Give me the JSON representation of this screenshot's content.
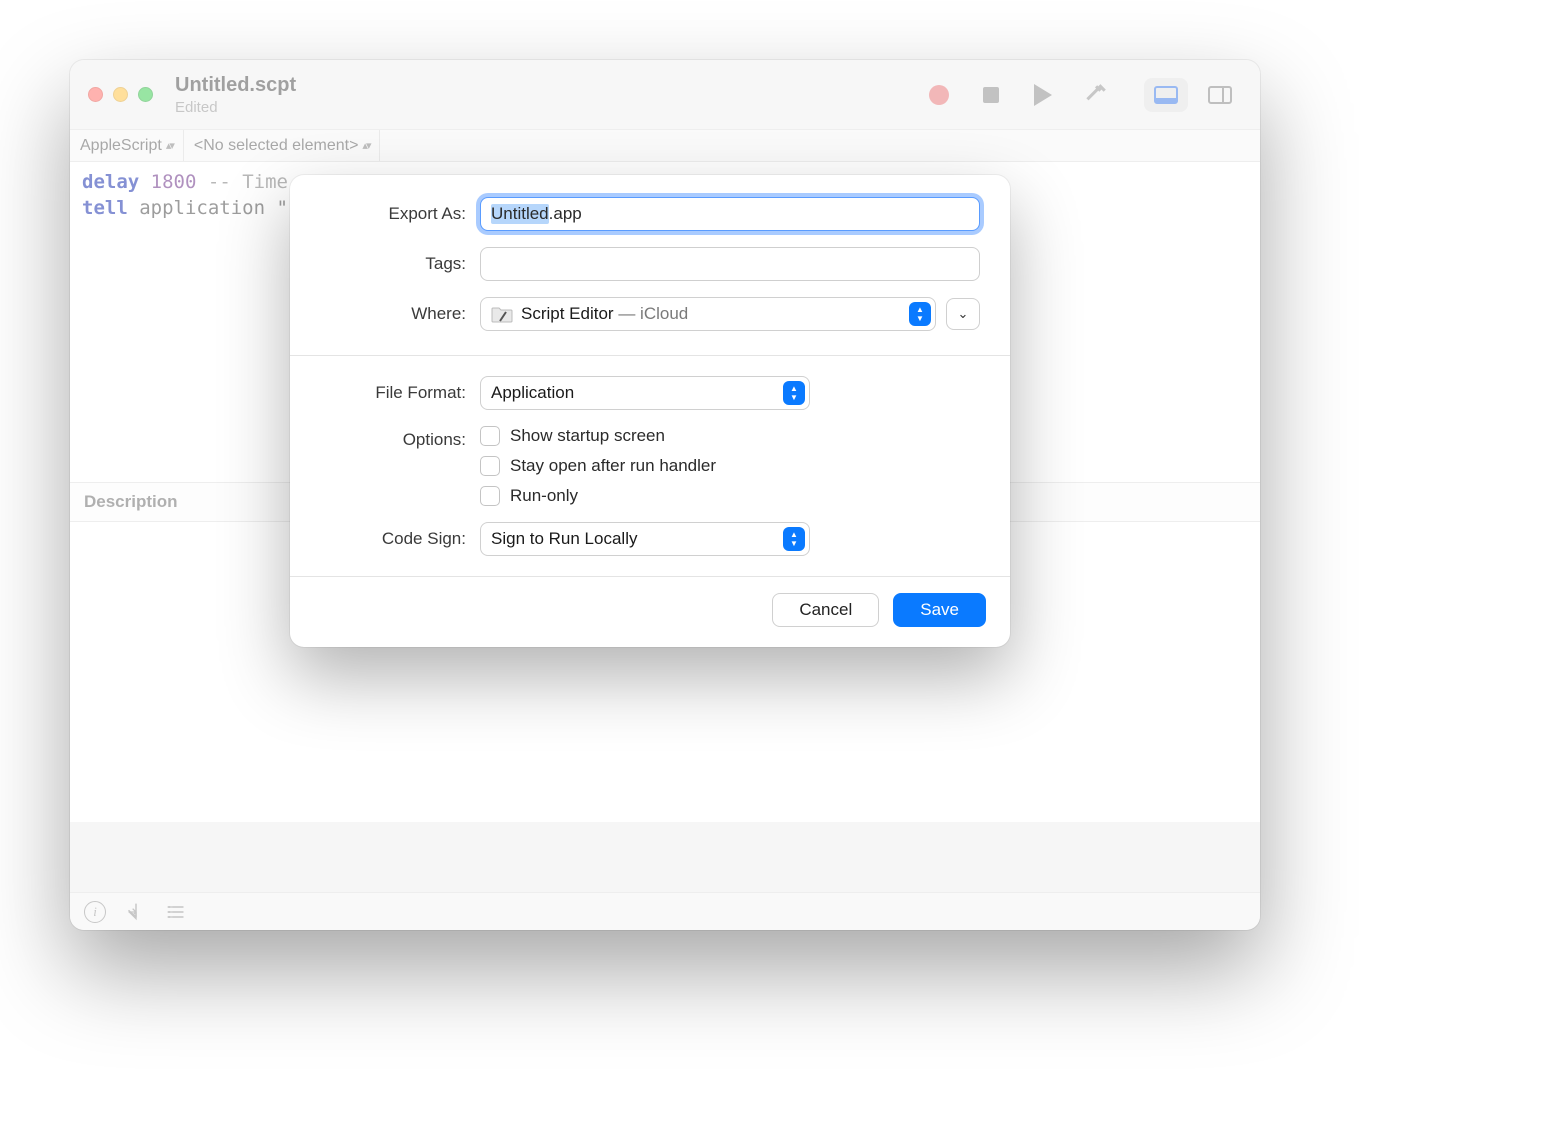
{
  "window": {
    "title": "Untitled.scpt",
    "subtitle": "Edited"
  },
  "subbar": {
    "language": "AppleScript",
    "element": "<No selected element>"
  },
  "code": {
    "line1_kw": "delay",
    "line1_num": "1800",
    "line1_comment": "-- Time",
    "line2_kw": "tell",
    "line2_rest": " application \""
  },
  "desc_header": "Description",
  "sheet": {
    "export_label": "Export As:",
    "filename_selected": "Untitled",
    "filename_suffix": ".app",
    "tags_label": "Tags:",
    "where_label": "Where:",
    "where_folder": "Script Editor",
    "where_sep": " — ",
    "where_cloud": "iCloud",
    "format_label": "File Format:",
    "format_value": "Application",
    "options_label": "Options:",
    "option1": "Show startup screen",
    "option2": "Stay open after run handler",
    "option3": "Run-only",
    "codesign_label": "Code Sign:",
    "codesign_value": "Sign to Run Locally",
    "cancel": "Cancel",
    "save": "Save"
  }
}
